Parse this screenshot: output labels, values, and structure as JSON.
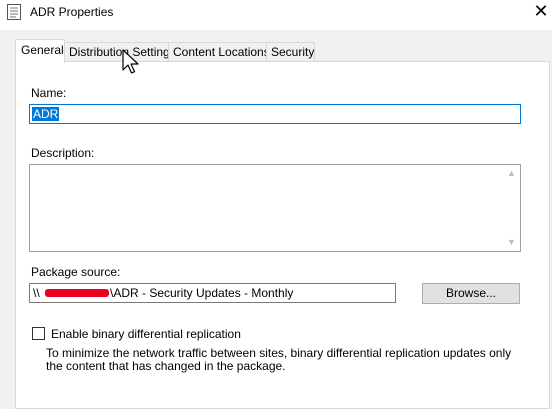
{
  "window": {
    "title": "ADR Properties",
    "close_glyph": "✕"
  },
  "tabs": [
    {
      "label": "General",
      "active": true
    },
    {
      "label": "Distribution Settings",
      "active": false
    },
    {
      "label": "Content Locations",
      "active": false
    },
    {
      "label": "Security",
      "active": false
    }
  ],
  "general": {
    "name_label": "Name:",
    "name_value": "ADR",
    "description_label": "Description:",
    "description_value": "",
    "package_source_label": "Package source:",
    "package_source_prefix": "\\\\",
    "package_source_path": "\\ADR - Security Updates - Monthly",
    "browse_label": "Browse...",
    "binary_replication_label": "Enable binary differential replication",
    "binary_replication_checked": false,
    "binary_replication_help": "To minimize the network traffic between sites, binary differential replication updates only the content that has changed in the package."
  },
  "icons": {
    "title_icon": "properties-icon",
    "cursor": "mouse-pointer-icon"
  }
}
